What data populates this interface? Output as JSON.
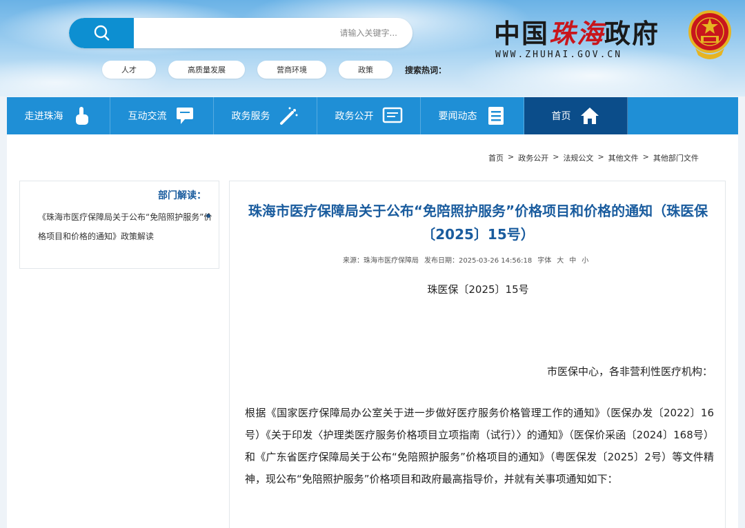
{
  "header": {
    "search": {
      "placeholder": "请输入关键字..."
    },
    "hot_label": "搜索热词：",
    "hot_words": [
      "人才",
      "高质量发展",
      "营商环境",
      "政策"
    ],
    "logo": {
      "black_text": "中国",
      "red_text": "珠海",
      "black_text2": "政府",
      "url": "WWW.ZHUHAI.GOV.CN"
    }
  },
  "nav": {
    "items": [
      {
        "label": "走进珠海",
        "icon": "hand-pointer-icon"
      },
      {
        "label": "互动交流",
        "icon": "chat-icon"
      },
      {
        "label": "政务服务",
        "icon": "wand-icon"
      },
      {
        "label": "政务公开",
        "icon": "window-icon"
      },
      {
        "label": "要闻动态",
        "icon": "list-icon"
      },
      {
        "label": "首页",
        "icon": "home-icon"
      }
    ]
  },
  "breadcrumb": [
    "首页",
    "政务公开",
    "法规公文",
    "其他文件",
    "其他部门文件"
  ],
  "sidebar": {
    "heading": "部门解读：",
    "link": "《珠海市医疗保障局关于公布“免陪照护服务”价格项目和价格的通知》政策解读"
  },
  "article": {
    "title": "珠海市医疗保障局关于公布“免陪照护服务”价格项目和价格的通知（珠医保〔2025〕15号）",
    "source": "来源：珠海市医疗保障局",
    "date": "发布日期：2025-03-26 14:56:18",
    "font_label": "字体",
    "font_sizes": [
      "大",
      "中",
      "小"
    ],
    "doc_no": "珠医保〔2025〕15号",
    "salutation": "市医保中心，各非营利性医疗机构：",
    "paragraph": "根据《国家医疗保障局办公室关于进一步做好医疗服务价格管理工作的通知》（医保办发〔2022〕16号）《关于印发〈护理类医疗服务价格项目立项指南（试行）〉的通知》（医保价采函〔2024〕168号）和《广东省医疗保障局关于公布“免陪照护服务”价格项目的通知》（粤医保发〔2025〕2号）等文件精神，现公布“免陪照护服务”价格项目和政府最高指导价，并就有关事项通知如下："
  },
  "colors": {
    "nav": "#1f8fd6",
    "nav_active": "#0b4d8a",
    "title": "#1a5c9e",
    "search_btn": "#0d8fd1"
  }
}
